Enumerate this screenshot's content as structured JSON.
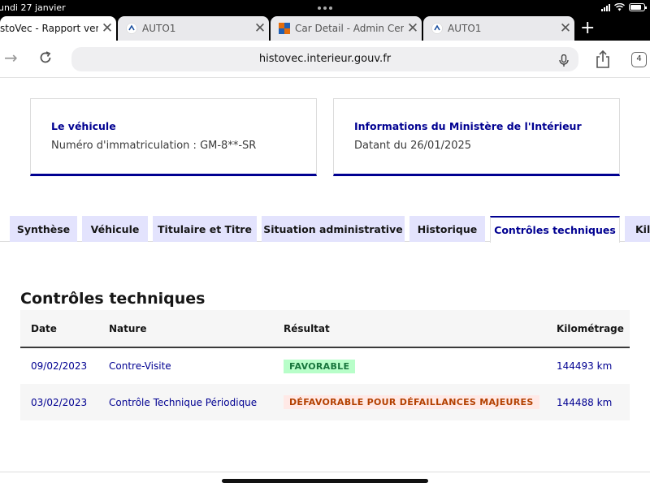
{
  "status_bar": {
    "date": "undi 27 janvier"
  },
  "browser_tabs": [
    {
      "title": "stoVec - Rapport vend",
      "icon": "histovec-favicon",
      "active": true
    },
    {
      "title": "AUTO1",
      "icon": "auto1-favicon",
      "active": false
    },
    {
      "title": "Car Detail - Admin Cente",
      "icon": "admin-center-favicon",
      "active": false
    },
    {
      "title": "AUTO1",
      "icon": "auto1-favicon",
      "active": false
    }
  ],
  "toolbar": {
    "url": "histovec.interieur.gouv.fr",
    "tab_count": "4"
  },
  "vehicle_card": {
    "heading": "Le véhicule",
    "text": "Numéro d'immatriculation : GM-8**-SR"
  },
  "ministry_card": {
    "heading": "Informations du Ministère de l'Intérieur",
    "text": "Datant du 26/01/2025"
  },
  "page_tabs": [
    {
      "label": "Synthèse"
    },
    {
      "label": "Véhicule"
    },
    {
      "label": "Titulaire et Titre"
    },
    {
      "label": "Situation administrative"
    },
    {
      "label": "Historique"
    },
    {
      "label": "Contrôles techniques",
      "active": true
    },
    {
      "label": "Kil"
    }
  ],
  "section": {
    "title": "Contrôles techniques"
  },
  "table": {
    "headers": [
      "Date",
      "Nature",
      "Résultat",
      "Kilométrage"
    ],
    "rows": [
      {
        "date": "09/02/2023",
        "nature": "Contre-Visite",
        "result": "FAVORABLE",
        "km": "144493 km"
      },
      {
        "date": "03/02/2023",
        "nature": "Contrôle Technique Périodique",
        "result": "DÉFAVORABLE POUR DÉFAILLANCES MAJEURES",
        "km": "144488 km"
      }
    ]
  },
  "colors": {
    "primary": "#000091",
    "tab_bg": "#e3e3fd",
    "favorable": "#18753c",
    "defavorable": "#b34000"
  }
}
